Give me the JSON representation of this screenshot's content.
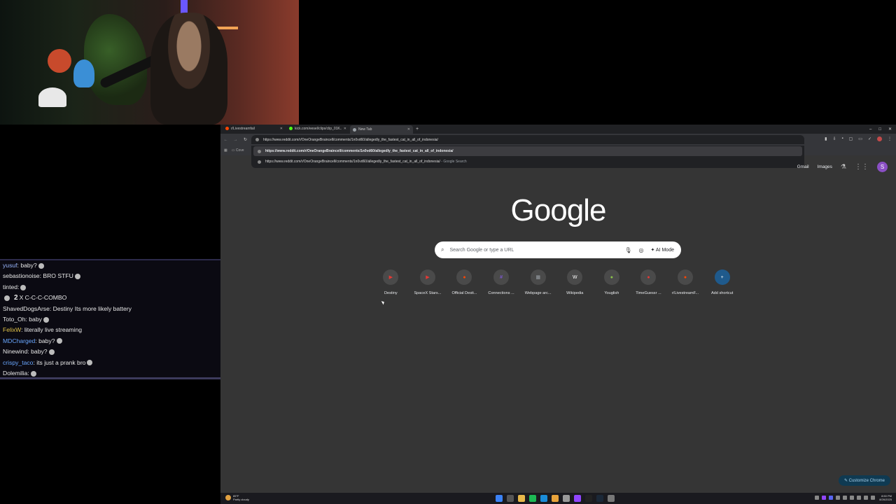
{
  "chat": {
    "lines": [
      {
        "user": "yusuf",
        "color": "#9ab7ff",
        "text": ": baby?"
      },
      {
        "user": "sebastionoise",
        "color": "#e8e8e8",
        "text": ": BRO STFU"
      },
      {
        "user": "tinted",
        "color": "#e8e8e8",
        "text": ":"
      },
      {
        "combo_num": "2",
        "text": "X C-C-C-COMBO"
      },
      {
        "user": "ShavedDogsArse",
        "color": "#e8e8e8",
        "text": ": Destiny Its more likely battery"
      },
      {
        "user": "Toto_Oh",
        "color": "#e8e8e8",
        "text": ": baby"
      },
      {
        "user": "FelixW",
        "color": "#e3c64a",
        "text": ": literally live streaming"
      },
      {
        "user": "MDCharged",
        "color": "#6aa7ff",
        "text": ": baby?"
      },
      {
        "user": "Ninewind",
        "color": "#e8e8e8",
        "text": ": baby?"
      },
      {
        "user": "crispy_taco",
        "color": "#6aa7ff",
        "text": ": its just a prank bro"
      },
      {
        "user": "Dolemilia",
        "color": "#e8e8e8",
        "text": ":"
      }
    ]
  },
  "browser": {
    "tabs": [
      {
        "label": "r/Livestreamfail",
        "fav_color": "#ff4500",
        "active": false
      },
      {
        "label": "kick.com/eesel/clips/clip_01K...",
        "fav_color": "#53fc18",
        "active": false
      },
      {
        "label": "New Tab",
        "fav_color": "#9aa0a6",
        "active": true
      }
    ],
    "newtab_symbol": "+",
    "window_controls": [
      "–",
      "□",
      "✕"
    ],
    "omnibox_text": "https://www.reddit.com/r/OneOrangeBraincell/comments/1n0vd60/allegedly_the_fastest_cat_in_all_of_indonesia/",
    "bookmark_label": "Cove",
    "suggestions": [
      {
        "text": "https://www.reddit.com/r/OneOrangeBraincell/comments/1n0vd60/allegedly_the_fastest_cat_in_all_of_indonesia/",
        "suffix": "",
        "selected": true
      },
      {
        "text": "https://www.reddit.com/r/OneOrangeBraincell/comments/1n0vd60/allegedly_the_fastest_cat_in_all_of_indonesia/",
        "suffix": " - Google Search",
        "selected": false
      }
    ],
    "top_links": {
      "gmail": "Gmail",
      "images": "Images",
      "profile_letter": "S"
    },
    "logo": "Google",
    "search": {
      "placeholder": "Search Google or type a URL",
      "ai_mode": "AI Mode"
    },
    "shortcuts": [
      {
        "label": "Destiny",
        "glyph": "▶",
        "color": "#e53935"
      },
      {
        "label": "SpaceX Stars...",
        "glyph": "▶",
        "color": "#e53935"
      },
      {
        "label": "Official Desti...",
        "glyph": "●",
        "color": "#ff4500"
      },
      {
        "label": "Connections ...",
        "glyph": "#",
        "color": "#8b5cf6"
      },
      {
        "label": "Webpage arc...",
        "glyph": "▦",
        "color": "#9aa0a6"
      },
      {
        "label": "Wikipedia",
        "glyph": "W",
        "color": "#ffffff"
      },
      {
        "label": "Youglish",
        "glyph": "●",
        "color": "#8bc34a"
      },
      {
        "label": "TimeGuessr ...",
        "glyph": "●",
        "color": "#e53935"
      },
      {
        "label": "r/LivestreamF...",
        "glyph": "●",
        "color": "#ff4500"
      },
      {
        "label": "Add shortcut",
        "glyph": "+",
        "color": "#ffffff",
        "add": true
      }
    ],
    "customize": "Customize Chrome"
  },
  "taskbar": {
    "weather_temp": "85°F",
    "weather_desc": "Partly cloudy",
    "time": "8:50 PM",
    "date": "8/26/2025"
  }
}
